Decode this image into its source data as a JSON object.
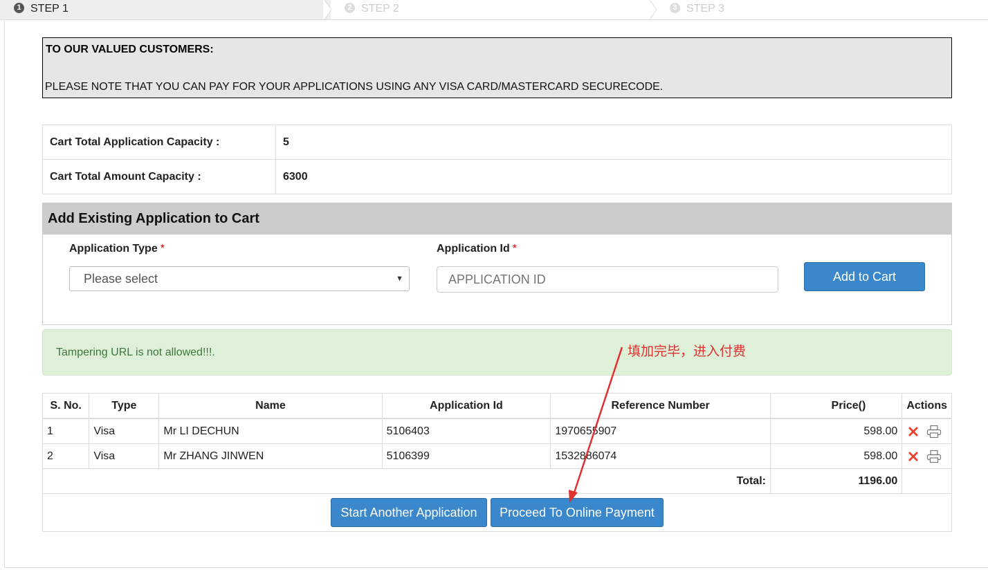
{
  "steps": [
    {
      "num": "1",
      "label": "STEP 1"
    },
    {
      "num": "2",
      "label": "STEP 2"
    },
    {
      "num": "3",
      "label": "STEP 3"
    }
  ],
  "notice": {
    "title": "TO OUR VALUED CUSTOMERS:",
    "text": "PLEASE NOTE THAT YOU CAN PAY FOR YOUR APPLICATIONS USING ANY VISA CARD/MASTERCARD SECURECODE."
  },
  "capacity": {
    "app_label": "Cart Total Application Capacity :",
    "app_value": "5",
    "amount_label": "Cart Total Amount Capacity :",
    "amount_value": "6300"
  },
  "add_panel": {
    "title": "Add Existing Application to Cart",
    "type_label": "Application Type",
    "type_selected": "Please select",
    "id_label": "Application Id",
    "id_placeholder": "APPLICATION ID",
    "required_mark": "*",
    "add_button": "Add to Cart"
  },
  "alert": {
    "message": "Tampering URL is not allowed!!!."
  },
  "annotation": {
    "text": "填加完毕，进入付费",
    "color": "#e03030"
  },
  "table": {
    "headers": [
      "S. No.",
      "Type",
      "Name",
      "Application Id",
      "Reference Number",
      "Price()",
      "Actions"
    ],
    "rows": [
      {
        "sno": "1",
        "type": "Visa",
        "name": "Mr LI DECHUN",
        "app_id": "5106403",
        "ref": "1970655907",
        "price": "598.00"
      },
      {
        "sno": "2",
        "type": "Visa",
        "name": "Mr ZHANG JINWEN",
        "app_id": "5106399",
        "ref": "1532886074",
        "price": "598.00"
      }
    ],
    "total_label": "Total:",
    "total_value": "1196.00"
  },
  "buttons": {
    "start_another": "Start Another Application",
    "proceed": "Proceed To Online Payment"
  },
  "icons": [
    "delete-icon",
    "print-icon"
  ],
  "colors": {
    "primary": "#3a87cc",
    "alert_bg": "#dff0d8",
    "alert_text": "#3c763d",
    "delete": "#e8432c"
  }
}
